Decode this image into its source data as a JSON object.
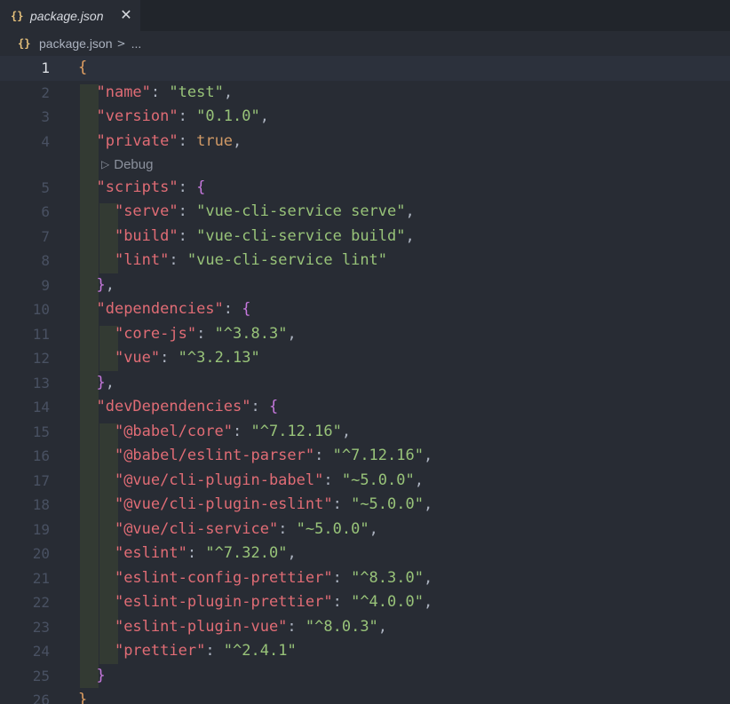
{
  "tab": {
    "icon": "{}",
    "title": "package.json",
    "close": "✕"
  },
  "breadcrumb": {
    "icon": "{}",
    "file": "package.json",
    "separator": ">",
    "more": "..."
  },
  "codelens": {
    "icon": "▷",
    "label": "Debug"
  },
  "colors": {
    "background": "#282c34",
    "key": "#e06c75",
    "string": "#98c379",
    "boolean": "#d19a66",
    "outer_brace": "#e5a263",
    "inner_brace": "#c678dd",
    "line_number": "#495162"
  },
  "current_line": 1,
  "lines": [
    {
      "n": "1",
      "tokens": [
        [
          "brace0",
          "{"
        ]
      ]
    },
    {
      "n": "2",
      "tokens": [
        [
          "ws",
          "  "
        ],
        [
          "key",
          "\"name\""
        ],
        [
          "punc",
          ": "
        ],
        [
          "str",
          "\"test\""
        ],
        [
          "punc",
          ","
        ]
      ]
    },
    {
      "n": "3",
      "tokens": [
        [
          "ws",
          "  "
        ],
        [
          "key",
          "\"version\""
        ],
        [
          "punc",
          ": "
        ],
        [
          "str",
          "\"0.1.0\""
        ],
        [
          "punc",
          ","
        ]
      ]
    },
    {
      "n": "4",
      "tokens": [
        [
          "ws",
          "  "
        ],
        [
          "key",
          "\"private\""
        ],
        [
          "punc",
          ": "
        ],
        [
          "bool",
          "true"
        ],
        [
          "punc",
          ","
        ]
      ]
    },
    {
      "n": "5",
      "tokens": [
        [
          "ws",
          "  "
        ],
        [
          "key",
          "\"scripts\""
        ],
        [
          "punc",
          ": "
        ],
        [
          "brace1",
          "{"
        ]
      ]
    },
    {
      "n": "6",
      "tokens": [
        [
          "ws",
          "    "
        ],
        [
          "key",
          "\"serve\""
        ],
        [
          "punc",
          ": "
        ],
        [
          "str",
          "\"vue-cli-service serve\""
        ],
        [
          "punc",
          ","
        ]
      ]
    },
    {
      "n": "7",
      "tokens": [
        [
          "ws",
          "    "
        ],
        [
          "key",
          "\"build\""
        ],
        [
          "punc",
          ": "
        ],
        [
          "str",
          "\"vue-cli-service build\""
        ],
        [
          "punc",
          ","
        ]
      ]
    },
    {
      "n": "8",
      "tokens": [
        [
          "ws",
          "    "
        ],
        [
          "key",
          "\"lint\""
        ],
        [
          "punc",
          ": "
        ],
        [
          "str",
          "\"vue-cli-service lint\""
        ]
      ]
    },
    {
      "n": "9",
      "tokens": [
        [
          "ws",
          "  "
        ],
        [
          "brace1",
          "}"
        ],
        [
          "punc",
          ","
        ]
      ]
    },
    {
      "n": "10",
      "tokens": [
        [
          "ws",
          "  "
        ],
        [
          "key",
          "\"dependencies\""
        ],
        [
          "punc",
          ": "
        ],
        [
          "brace1",
          "{"
        ]
      ]
    },
    {
      "n": "11",
      "tokens": [
        [
          "ws",
          "    "
        ],
        [
          "key",
          "\"core-js\""
        ],
        [
          "punc",
          ": "
        ],
        [
          "str",
          "\"^3.8.3\""
        ],
        [
          "punc",
          ","
        ]
      ]
    },
    {
      "n": "12",
      "tokens": [
        [
          "ws",
          "    "
        ],
        [
          "key",
          "\"vue\""
        ],
        [
          "punc",
          ": "
        ],
        [
          "str",
          "\"^3.2.13\""
        ]
      ]
    },
    {
      "n": "13",
      "tokens": [
        [
          "ws",
          "  "
        ],
        [
          "brace1",
          "}"
        ],
        [
          "punc",
          ","
        ]
      ]
    },
    {
      "n": "14",
      "tokens": [
        [
          "ws",
          "  "
        ],
        [
          "key",
          "\"devDependencies\""
        ],
        [
          "punc",
          ": "
        ],
        [
          "brace1",
          "{"
        ]
      ]
    },
    {
      "n": "15",
      "tokens": [
        [
          "ws",
          "    "
        ],
        [
          "key",
          "\"@babel/core\""
        ],
        [
          "punc",
          ": "
        ],
        [
          "str",
          "\"^7.12.16\""
        ],
        [
          "punc",
          ","
        ]
      ]
    },
    {
      "n": "16",
      "tokens": [
        [
          "ws",
          "    "
        ],
        [
          "key",
          "\"@babel/eslint-parser\""
        ],
        [
          "punc",
          ": "
        ],
        [
          "str",
          "\"^7.12.16\""
        ],
        [
          "punc",
          ","
        ]
      ]
    },
    {
      "n": "17",
      "tokens": [
        [
          "ws",
          "    "
        ],
        [
          "key",
          "\"@vue/cli-plugin-babel\""
        ],
        [
          "punc",
          ": "
        ],
        [
          "str",
          "\"~5.0.0\""
        ],
        [
          "punc",
          ","
        ]
      ]
    },
    {
      "n": "18",
      "tokens": [
        [
          "ws",
          "    "
        ],
        [
          "key",
          "\"@vue/cli-plugin-eslint\""
        ],
        [
          "punc",
          ": "
        ],
        [
          "str",
          "\"~5.0.0\""
        ],
        [
          "punc",
          ","
        ]
      ]
    },
    {
      "n": "19",
      "tokens": [
        [
          "ws",
          "    "
        ],
        [
          "key",
          "\"@vue/cli-service\""
        ],
        [
          "punc",
          ": "
        ],
        [
          "str",
          "\"~5.0.0\""
        ],
        [
          "punc",
          ","
        ]
      ]
    },
    {
      "n": "20",
      "tokens": [
        [
          "ws",
          "    "
        ],
        [
          "key",
          "\"eslint\""
        ],
        [
          "punc",
          ": "
        ],
        [
          "str",
          "\"^7.32.0\""
        ],
        [
          "punc",
          ","
        ]
      ]
    },
    {
      "n": "21",
      "tokens": [
        [
          "ws",
          "    "
        ],
        [
          "key",
          "\"eslint-config-prettier\""
        ],
        [
          "punc",
          ": "
        ],
        [
          "str",
          "\"^8.3.0\""
        ],
        [
          "punc",
          ","
        ]
      ]
    },
    {
      "n": "22",
      "tokens": [
        [
          "ws",
          "    "
        ],
        [
          "key",
          "\"eslint-plugin-prettier\""
        ],
        [
          "punc",
          ": "
        ],
        [
          "str",
          "\"^4.0.0\""
        ],
        [
          "punc",
          ","
        ]
      ]
    },
    {
      "n": "23",
      "tokens": [
        [
          "ws",
          "    "
        ],
        [
          "key",
          "\"eslint-plugin-vue\""
        ],
        [
          "punc",
          ": "
        ],
        [
          "str",
          "\"^8.0.3\""
        ],
        [
          "punc",
          ","
        ]
      ]
    },
    {
      "n": "24",
      "tokens": [
        [
          "ws",
          "    "
        ],
        [
          "key",
          "\"prettier\""
        ],
        [
          "punc",
          ": "
        ],
        [
          "str",
          "\"^2.4.1\""
        ]
      ]
    },
    {
      "n": "25",
      "tokens": [
        [
          "ws",
          "  "
        ],
        [
          "brace1",
          "}"
        ]
      ]
    },
    {
      "n": "26",
      "tokens": [
        [
          "brace0",
          "}"
        ]
      ]
    }
  ]
}
